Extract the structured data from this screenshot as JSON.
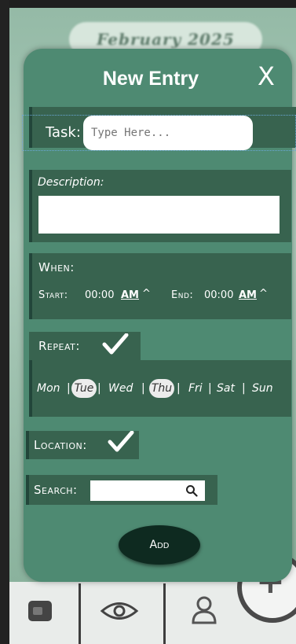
{
  "background": {
    "month_year": "February 2025"
  },
  "modal": {
    "title": "New Entry",
    "close_label": "X",
    "task": {
      "label": "Task:",
      "placeholder": "Type Here..."
    },
    "description": {
      "label": "Description:",
      "value": ""
    },
    "when": {
      "label": "When:",
      "start_label": "Start:",
      "start_time": "00:00",
      "start_ampm": "AM",
      "end_label": "End:",
      "end_time": "00:00",
      "end_ampm": "AM",
      "caret": "^"
    },
    "repeat": {
      "label": "Repeat:",
      "checked": true,
      "days": [
        {
          "label": "Mon",
          "selected": false
        },
        {
          "label": "Tue",
          "selected": true
        },
        {
          "label": "Wed",
          "selected": false
        },
        {
          "label": "Thu",
          "selected": true
        },
        {
          "label": "Fri",
          "selected": false
        },
        {
          "label": "Sat",
          "selected": false
        },
        {
          "label": "Sun",
          "selected": false
        }
      ],
      "separator": "|"
    },
    "location": {
      "label": "Location:",
      "checked": true
    },
    "search": {
      "label": "Search:",
      "value": "",
      "icon": "search-icon"
    },
    "add_label": "Add"
  },
  "colors": {
    "modal_bg": "#4e8a72",
    "section_bg": "#38634f",
    "add_button": "#0e2a20"
  },
  "bottom_nav": {
    "items": [
      "calendar-icon",
      "eye-icon",
      "person-icon"
    ],
    "fab_label": "+"
  }
}
